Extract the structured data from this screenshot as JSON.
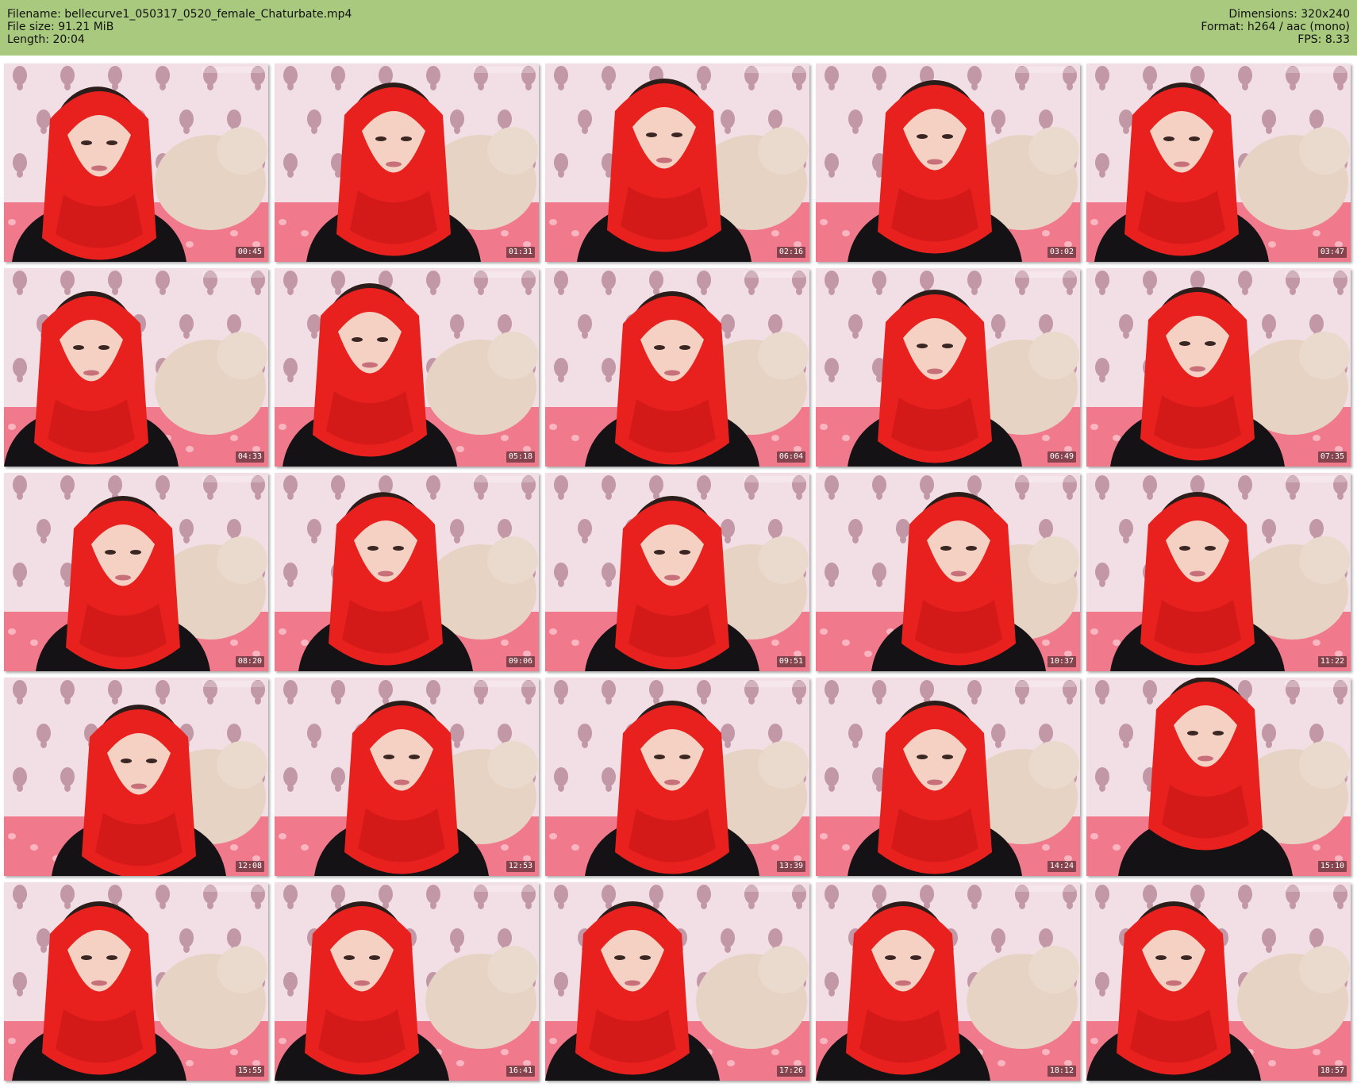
{
  "header": {
    "filename_line": "Filename: bellecurve1_050317_0520_female_Chaturbate.mp4",
    "filesize_line": "File size: 91.21 MiB",
    "length_line": "Length: 20:04",
    "dimensions_line": "Dimensions: 320x240",
    "format_line": "Format: h264 / aac (mono)",
    "fps_line": "FPS: 8.33"
  },
  "colors": {
    "header_bg": "#a9c97e",
    "scarf_red": "#e8211e",
    "wallpaper": "#f2dfe6",
    "bed_pink": "#f07a8c"
  },
  "timestamps": [
    "00:45",
    "01:31",
    "02:16",
    "03:02",
    "03:47",
    "04:33",
    "05:18",
    "06:04",
    "06:49",
    "07:35",
    "08:20",
    "09:06",
    "09:51",
    "10:37",
    "11:22",
    "12:08",
    "12:53",
    "13:39",
    "14:24",
    "15:10",
    "15:55",
    "16:41",
    "17:26",
    "18:12",
    "18:57"
  ]
}
